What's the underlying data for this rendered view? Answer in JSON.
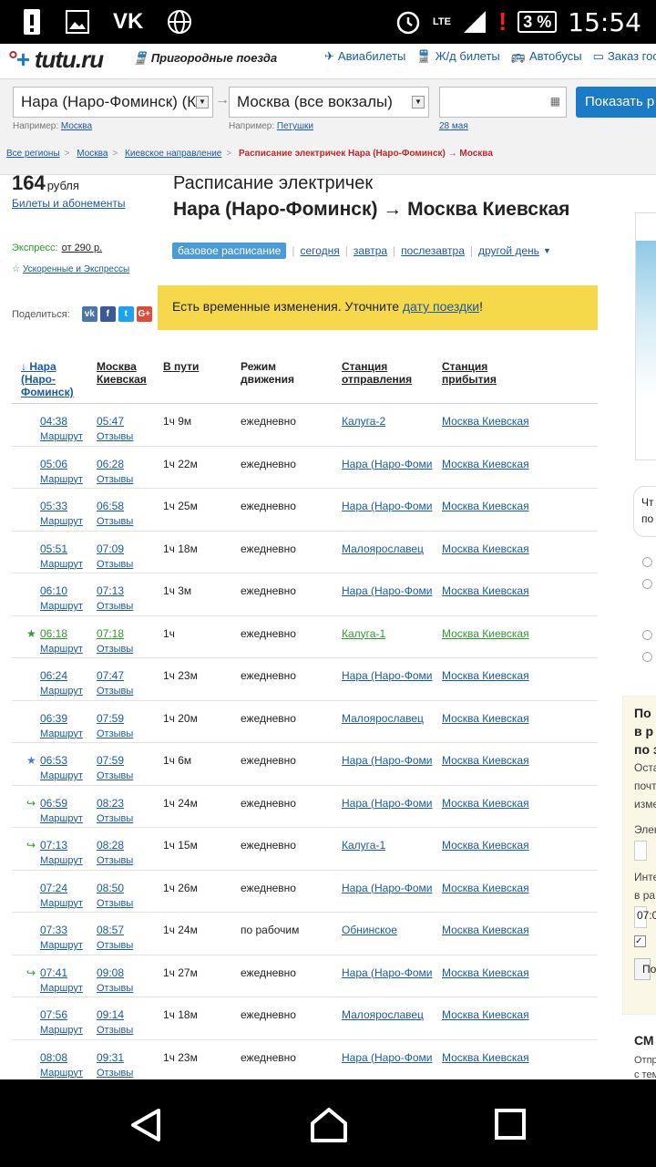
{
  "status_bar": {
    "time": "15:54",
    "battery": "3 %",
    "network": "LTE"
  },
  "header": {
    "logo": "tutu.ru",
    "section": "Пригородные поезда",
    "nav": [
      "Авиабилеты",
      "Ж/д билеты",
      "Автобусы",
      "Заказ гос"
    ]
  },
  "search": {
    "from_value": "Нара (Наро-Фоминск) (К",
    "to_value": "Москва (все вокзалы)",
    "date_value": "",
    "from_hint_label": "Например:",
    "from_hint_link": "Москва",
    "to_hint_label": "Например:",
    "to_hint_link": "Петушки",
    "date_hint": "28 мая",
    "button_label": "Показать р"
  },
  "breadcrumbs": [
    "Все регионы",
    "Москва",
    "Киевское направление",
    "Расписание электричек Нара (Наро-Фоминск) → Москва"
  ],
  "price": {
    "value": "164",
    "unit": "рубля",
    "tickets_link": "Билеты и абонементы"
  },
  "express": {
    "label": "Экспресс:",
    "value": "от 290 р.",
    "fast_link": "Ускоренные и Экспрессы"
  },
  "title": {
    "line1": "Расписание электричек",
    "line2": "Нара (Наро-Фоминск) → Москва Киевская"
  },
  "tabs": {
    "active": "базовое расписание",
    "items": [
      "сегодня",
      "завтра",
      "послезавтра",
      "другой день"
    ]
  },
  "share": {
    "label": "Поделиться:"
  },
  "notice": {
    "text": "Есть временные изменения. Уточните ",
    "link": "дату поездки",
    "tail": "!"
  },
  "table": {
    "headers": [
      "↓ Нара (Наро-Фоминск)",
      "Москва Киевская",
      "В пути",
      "Режим движения",
      "Станция отправления",
      "Станция прибытия"
    ],
    "route_label": "Маршрут",
    "reviews_label": "Отзывы",
    "rows": [
      {
        "mark": "",
        "dep": "04:38",
        "arr": "05:47",
        "dur": "1ч 9м",
        "mode": "ежедневно",
        "from": "Калуга-2",
        "to": "Москва Киевская"
      },
      {
        "mark": "",
        "dep": "05:06",
        "arr": "06:28",
        "dur": "1ч 22м",
        "mode": "ежедневно",
        "from": "Нара (Наро-Фоми",
        "to": "Москва Киевская"
      },
      {
        "mark": "",
        "dep": "05:33",
        "arr": "06:58",
        "dur": "1ч 25м",
        "mode": "ежедневно",
        "from": "Нара (Наро-Фоми",
        "to": "Москва Киевская"
      },
      {
        "mark": "",
        "dep": "05:51",
        "arr": "07:09",
        "dur": "1ч 18м",
        "mode": "ежедневно",
        "from": "Малоярославец",
        "to": "Москва Киевская"
      },
      {
        "mark": "",
        "dep": "06:10",
        "arr": "07:13",
        "dur": "1ч 3м",
        "mode": "ежедневно",
        "from": "Нара (Наро-Фоми",
        "to": "Москва Киевская"
      },
      {
        "mark": "★",
        "dep": "06:18",
        "arr": "07:18",
        "dur": "1ч",
        "mode": "ежедневно",
        "from": "Калуга-1",
        "to": "Москва Киевская",
        "green": true
      },
      {
        "mark": "",
        "dep": "06:24",
        "arr": "07:47",
        "dur": "1ч 23м",
        "mode": "ежедневно",
        "from": "Нара (Наро-Фоми",
        "to": "Москва Киевская"
      },
      {
        "mark": "",
        "dep": "06:39",
        "arr": "07:59",
        "dur": "1ч 20м",
        "mode": "ежедневно",
        "from": "Малоярославец",
        "to": "Москва Киевская"
      },
      {
        "mark": "★",
        "dep": "06:53",
        "arr": "07:59",
        "dur": "1ч 6м",
        "mode": "ежедневно",
        "from": "Нара (Наро-Фоми",
        "to": "Москва Киевская",
        "blue": true
      },
      {
        "mark": "↪",
        "dep": "06:59",
        "arr": "08:23",
        "dur": "1ч 24м",
        "mode": "ежедневно",
        "from": "Нара (Наро-Фоми",
        "to": "Москва Киевская"
      },
      {
        "mark": "↪",
        "dep": "07:13",
        "arr": "08:28",
        "dur": "1ч 15м",
        "mode": "ежедневно",
        "from": "Калуга-1",
        "to": "Москва Киевская"
      },
      {
        "mark": "",
        "dep": "07:24",
        "arr": "08:50",
        "dur": "1ч 26м",
        "mode": "ежедневно",
        "from": "Нара (Наро-Фоми",
        "to": "Москва Киевская"
      },
      {
        "mark": "",
        "dep": "07:33",
        "arr": "08:57",
        "dur": "1ч 24м",
        "mode": "по рабочим",
        "from": "Обнинское",
        "to": "Москва Киевская"
      },
      {
        "mark": "↪",
        "dep": "07:41",
        "arr": "09:08",
        "dur": "1ч 27м",
        "mode": "ежедневно",
        "from": "Нара (Наро-Фоми",
        "to": "Москва Киевская"
      },
      {
        "mark": "",
        "dep": "07:56",
        "arr": "09:14",
        "dur": "1ч 18м",
        "mode": "ежедневно",
        "from": "Малоярославец",
        "to": "Москва Киевская"
      },
      {
        "mark": "",
        "dep": "08:08",
        "arr": "09:31",
        "dur": "1ч 23м",
        "mode": "ежедневно",
        "from": "Нара (Наро-Фоми",
        "to": "Москва Киевская"
      }
    ]
  },
  "right": {
    "bubble": [
      "Чт",
      "по"
    ],
    "subscribe_lines": [
      "По",
      "в р",
      "по з",
      "Оста",
      "почт",
      "изме",
      "Элек",
      "Инте",
      "в ра",
      "07:0",
      "По"
    ],
    "smo_title": "СМ",
    "smo_text": [
      "Отпр",
      "с тем"
    ]
  },
  "colors": {
    "accent": "#1a7bc6",
    "link": "#1a5aa6",
    "notice": "#f5d94a",
    "express": "#2e9c2e",
    "crumb_current": "#c1272d"
  }
}
